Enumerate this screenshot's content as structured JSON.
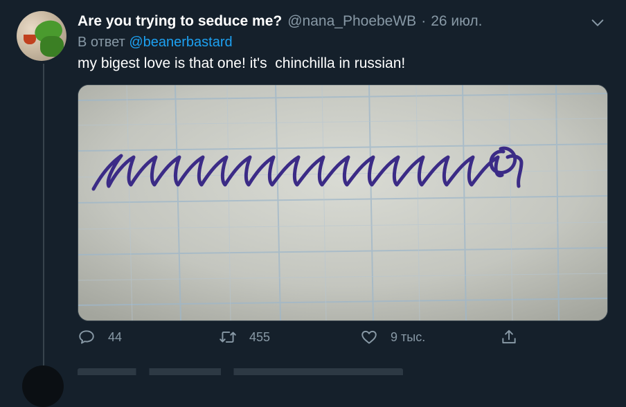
{
  "tweet": {
    "author_name": "Are you trying to seduce me?",
    "author_handle": "@nana_PhoebeWB",
    "separator": "·",
    "date": "26 июл.",
    "reply_prefix": "В ответ",
    "reply_to": "@beanerbastard",
    "text": "my bigest love is that one! it's  chinchilla in russian!",
    "media_icon": "handwriting-photo",
    "actions": {
      "replies": "44",
      "retweets": "455",
      "likes": "9 тыс."
    }
  },
  "colors": {
    "background": "#15202b",
    "secondary_text": "#8899a6",
    "link": "#1da1f2",
    "divider": "#38444d"
  },
  "icons": [
    "chevron-down-icon",
    "reply-icon",
    "retweet-icon",
    "like-icon",
    "share-icon"
  ]
}
